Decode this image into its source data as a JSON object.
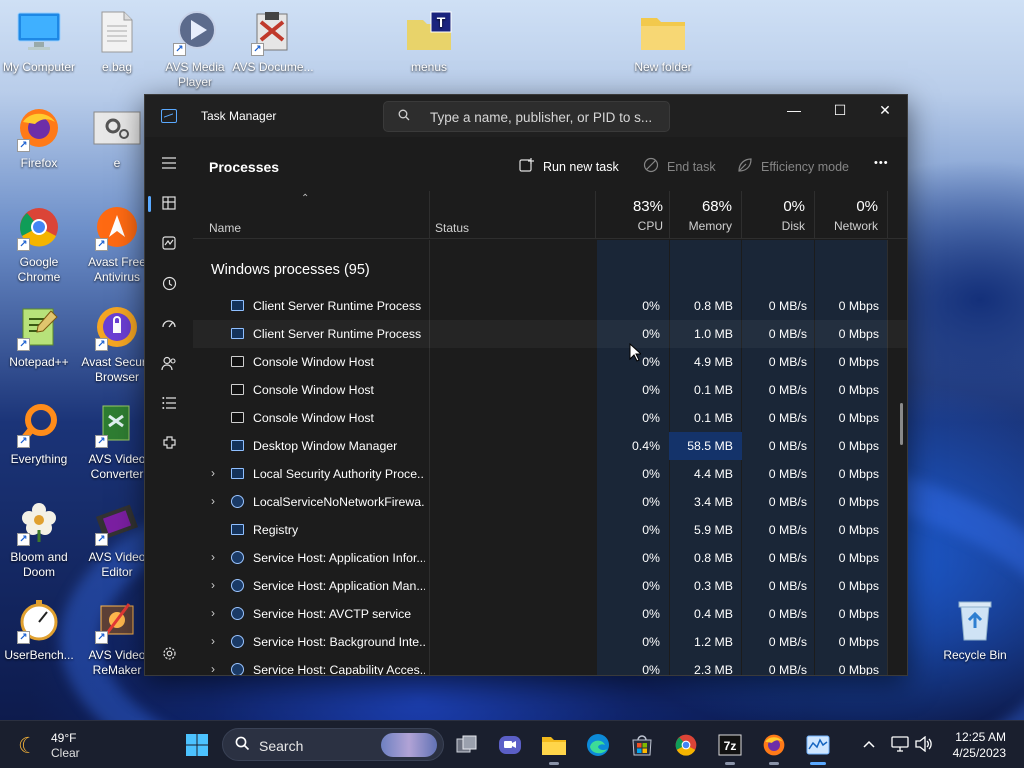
{
  "desktop": {
    "icons": {
      "my_computer": "My Computer",
      "ebag": "e.bag",
      "avs_media_player": "AVS Media Player",
      "avs_document": "AVS Docume...",
      "menus": "menus",
      "new_folder": "New folder",
      "firefox": "Firefox",
      "e": "e",
      "google_chrome": "Google Chrome",
      "avast_antivirus": "Avast Free Antivirus",
      "notepadpp": "Notepad++",
      "avast_browser": "Avast Secure Browser",
      "everything": "Everything",
      "avs_video_converter": "AVS Video Converter",
      "bloom_and_doom": "Bloom and Doom",
      "avs_video_editor": "AVS Video Editor",
      "userbench": "UserBench...",
      "avs_video_remaker": "AVS Video ReMaker",
      "recycle_bin": "Recycle Bin"
    }
  },
  "window": {
    "title": "Task Manager",
    "search_placeholder": "Type a name, publisher, or PID to s...",
    "controls": {
      "minimize": "—",
      "maximize": "☐",
      "close": "✕"
    }
  },
  "commandbar": {
    "heading": "Processes",
    "run_new_task": "Run new task",
    "end_task": "End task",
    "efficiency_mode": "Efficiency mode",
    "more": "•••"
  },
  "table": {
    "columns": {
      "name": "Name",
      "status": "Status",
      "cpu_pct": "83%",
      "cpu": "CPU",
      "memory_pct": "68%",
      "memory": "Memory",
      "disk_pct": "0%",
      "disk": "Disk",
      "network_pct": "0%",
      "network": "Network"
    },
    "group_label": "Windows processes (95)",
    "rows": [
      {
        "name": "Client Server Runtime Process",
        "cpu": "0%",
        "mem": "0.8 MB",
        "disk": "0 MB/s",
        "net": "0 Mbps"
      },
      {
        "name": "Client Server Runtime Process",
        "cpu": "0%",
        "mem": "1.0 MB",
        "disk": "0 MB/s",
        "net": "0 Mbps"
      },
      {
        "name": "Console Window Host",
        "cpu": "0%",
        "mem": "4.9 MB",
        "disk": "0 MB/s",
        "net": "0 Mbps"
      },
      {
        "name": "Console Window Host",
        "cpu": "0%",
        "mem": "0.1 MB",
        "disk": "0 MB/s",
        "net": "0 Mbps"
      },
      {
        "name": "Console Window Host",
        "cpu": "0%",
        "mem": "0.1 MB",
        "disk": "0 MB/s",
        "net": "0 Mbps"
      },
      {
        "name": "Desktop Window Manager",
        "cpu": "0.4%",
        "mem": "58.5 MB",
        "disk": "0 MB/s",
        "net": "0 Mbps"
      },
      {
        "name": "Local Security Authority Proce...",
        "cpu": "0%",
        "mem": "4.4 MB",
        "disk": "0 MB/s",
        "net": "0 Mbps"
      },
      {
        "name": "LocalServiceNoNetworkFirewa...",
        "cpu": "0%",
        "mem": "3.4 MB",
        "disk": "0 MB/s",
        "net": "0 Mbps"
      },
      {
        "name": "Registry",
        "cpu": "0%",
        "mem": "5.9 MB",
        "disk": "0 MB/s",
        "net": "0 Mbps"
      },
      {
        "name": "Service Host: Application Infor...",
        "cpu": "0%",
        "mem": "0.8 MB",
        "disk": "0 MB/s",
        "net": "0 Mbps"
      },
      {
        "name": "Service Host: Application Man...",
        "cpu": "0%",
        "mem": "0.3 MB",
        "disk": "0 MB/s",
        "net": "0 Mbps"
      },
      {
        "name": "Service Host: AVCTP service",
        "cpu": "0%",
        "mem": "0.4 MB",
        "disk": "0 MB/s",
        "net": "0 Mbps"
      },
      {
        "name": "Service Host: Background Inte...",
        "cpu": "0%",
        "mem": "1.2 MB",
        "disk": "0 MB/s",
        "net": "0 Mbps"
      },
      {
        "name": "Service Host: Capability Acces...",
        "cpu": "0%",
        "mem": "2.3 MB",
        "disk": "0 MB/s",
        "net": "0 Mbps"
      }
    ]
  },
  "taskbar": {
    "weather_temp": "49°F",
    "weather_cond": "Clear",
    "search_label": "Search",
    "time": "12:25 AM",
    "date": "4/25/2023"
  },
  "colors": {
    "accent": "#5aa9ff",
    "heatmap": "#1a2637",
    "memory_highlight": "#14336a"
  }
}
